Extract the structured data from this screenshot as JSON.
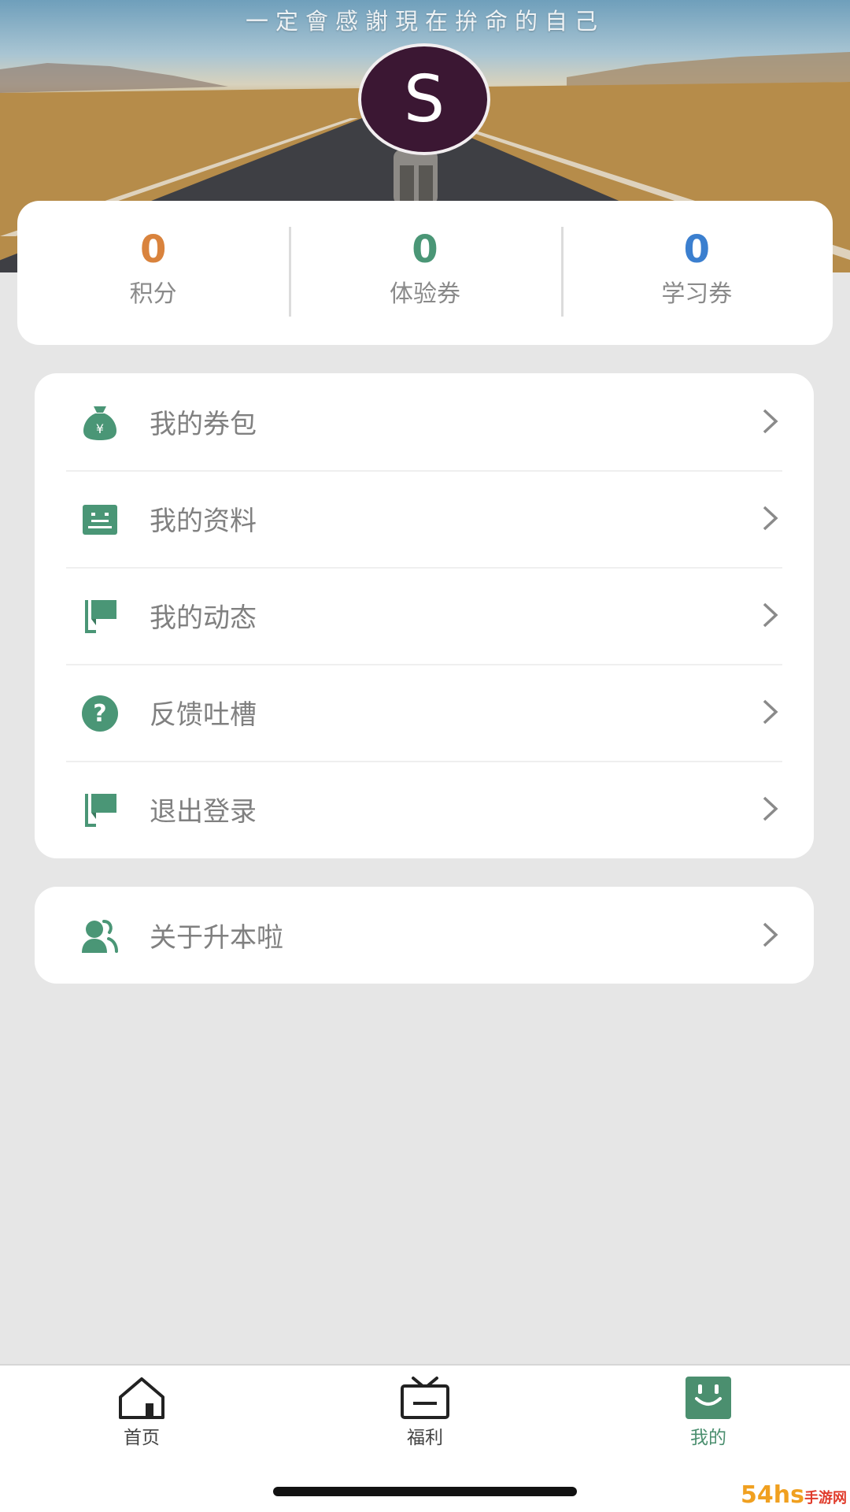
{
  "header": {
    "slogan": "一定會感謝現在拚命的自己",
    "avatar_letter": "S"
  },
  "stats": [
    {
      "value": "0",
      "label": "积分",
      "color": "#d9833d"
    },
    {
      "value": "0",
      "label": "体验券",
      "color": "#4a9676"
    },
    {
      "value": "0",
      "label": "学习券",
      "color": "#3b7fcf"
    }
  ],
  "menu": {
    "items": [
      {
        "label": "我的券包",
        "icon": "money-bag-icon"
      },
      {
        "label": "我的资料",
        "icon": "profile-card-icon"
      },
      {
        "label": "我的动态",
        "icon": "flag-icon"
      },
      {
        "label": "反馈吐槽",
        "icon": "question-circle-icon"
      },
      {
        "label": "退出登录",
        "icon": "flag-icon"
      }
    ],
    "about": {
      "label": "关于升本啦",
      "icon": "users-icon"
    }
  },
  "tabs": [
    {
      "label": "首页",
      "icon": "home-icon",
      "active": false
    },
    {
      "label": "福利",
      "icon": "tv-gift-icon",
      "active": false
    },
    {
      "label": "我的",
      "icon": "smile-face-icon",
      "active": true
    }
  ],
  "watermark": {
    "text": "54hs",
    "sub": "手游网"
  },
  "theme": {
    "accent": "#4b8f6f",
    "icon_green": "#4a9676"
  }
}
